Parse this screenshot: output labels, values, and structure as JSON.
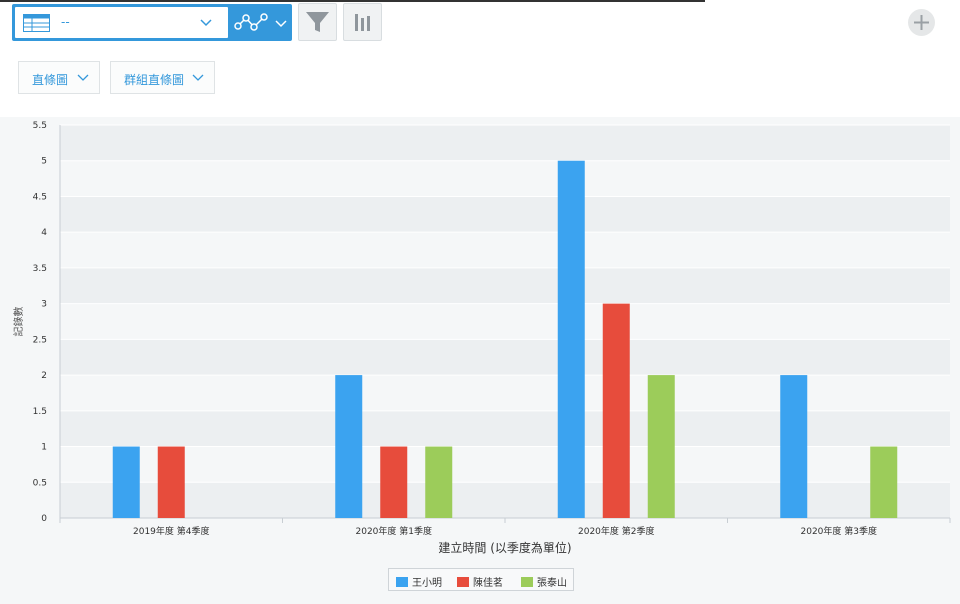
{
  "toolbar": {
    "view_name": "--",
    "icons": [
      "table-icon",
      "chevron-down-icon",
      "graph-icon",
      "filter-icon",
      "bar-chart-icon",
      "plus-icon"
    ]
  },
  "chart_options": {
    "type_label": "直條圖",
    "subtype_label": "群組直條圖"
  },
  "colors": {
    "accent": "#3498db",
    "series": [
      "#3ba3f0",
      "#e74c3c",
      "#9ccc5a"
    ]
  },
  "chart_data": {
    "type": "bar",
    "categories": [
      "2019年度 第4季度",
      "2020年度 第1季度",
      "2020年度 第2季度",
      "2020年度 第3季度"
    ],
    "series": [
      {
        "name": "王小明",
        "values": [
          1,
          2,
          5,
          2
        ]
      },
      {
        "name": "陳佳茗",
        "values": [
          1,
          1,
          3,
          0
        ]
      },
      {
        "name": "張泰山",
        "values": [
          0,
          1,
          2,
          1
        ]
      }
    ],
    "xlabel": "建立時間 (以季度為單位)",
    "ylabel": "記錄數",
    "ylim": [
      0,
      5.5
    ],
    "yticks": [
      "0",
      "0.5",
      "1",
      "1.5",
      "2",
      "2.5",
      "3",
      "3.5",
      "4",
      "4.5",
      "5",
      "5.5"
    ],
    "grid": true,
    "legend_position": "bottom"
  }
}
